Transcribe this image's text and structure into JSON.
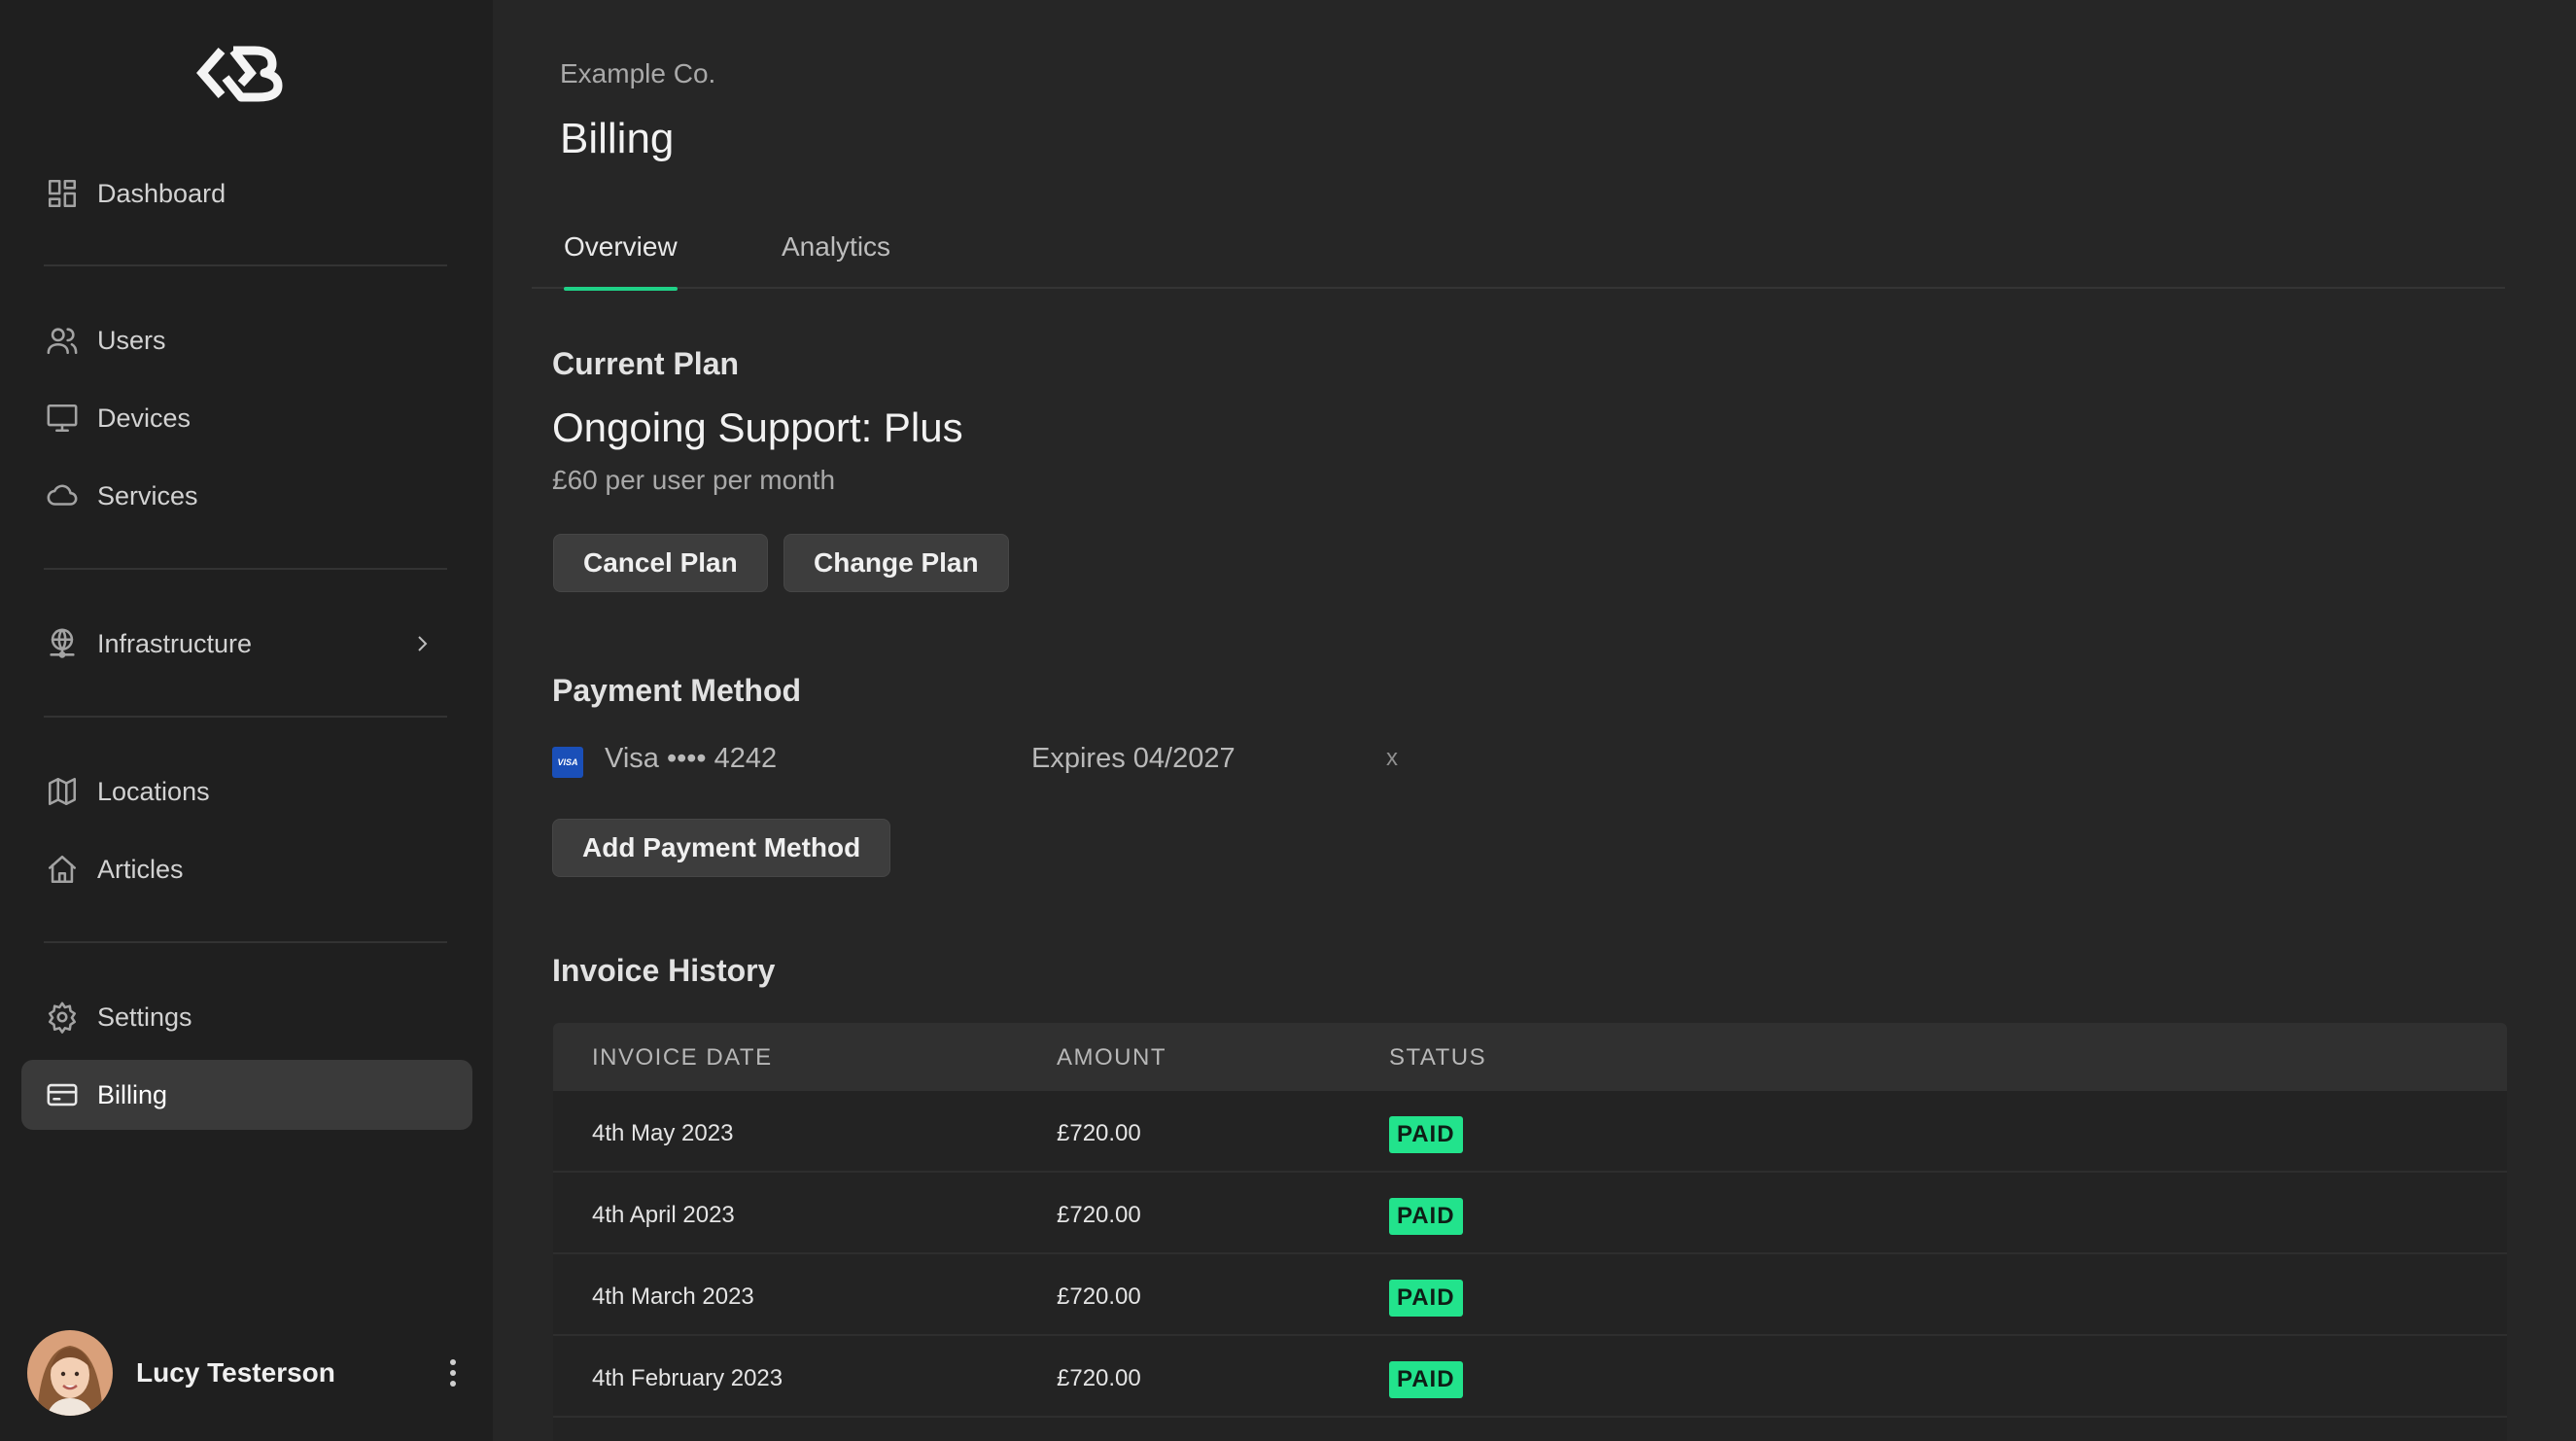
{
  "sidebar": {
    "logo_icon": "brand-logo-icon",
    "items": [
      {
        "label": "Dashboard",
        "icon": "dashboard-icon"
      },
      {
        "label": "Users",
        "icon": "users-icon"
      },
      {
        "label": "Devices",
        "icon": "monitor-icon"
      },
      {
        "label": "Services",
        "icon": "cloud-icon"
      },
      {
        "label": "Infrastructure",
        "icon": "globe-network-icon"
      },
      {
        "label": "Locations",
        "icon": "map-icon"
      },
      {
        "label": "Articles",
        "icon": "home-icon"
      },
      {
        "label": "Settings",
        "icon": "gear-icon"
      },
      {
        "label": "Billing",
        "icon": "credit-card-icon"
      }
    ],
    "active_item": "Billing",
    "user": {
      "name": "Lucy Testerson"
    }
  },
  "header": {
    "org": "Example Co.",
    "title": "Billing",
    "tabs": [
      {
        "label": "Overview"
      },
      {
        "label": "Analytics"
      }
    ],
    "active_tab": "Overview"
  },
  "plan": {
    "heading": "Current Plan",
    "name": "Ongoing Support: Plus",
    "price": "£60 per user per month",
    "cancel_label": "Cancel Plan",
    "change_label": "Change Plan"
  },
  "payment": {
    "heading": "Payment Method",
    "card_brand": "VISA",
    "card": "Visa •••• 4242",
    "expiry": "Expires 04/2027",
    "remove": "x",
    "add_label": "Add Payment Method"
  },
  "invoices": {
    "heading": "Invoice History",
    "columns": [
      "INVOICE DATE",
      "AMOUNT",
      "STATUS"
    ],
    "rows": [
      {
        "date": "4th May 2023",
        "amount": "£720.00",
        "status": "PAID"
      },
      {
        "date": "4th April 2023",
        "amount": "£720.00",
        "status": "PAID"
      },
      {
        "date": "4th March 2023",
        "amount": "£720.00",
        "status": "PAID"
      },
      {
        "date": "4th February 2023",
        "amount": "£720.00",
        "status": "PAID"
      }
    ]
  },
  "colors": {
    "accent": "#1fd187",
    "badge_paid": "#22e38c",
    "background": "#262626",
    "sidebar": "#1f1f1f"
  }
}
